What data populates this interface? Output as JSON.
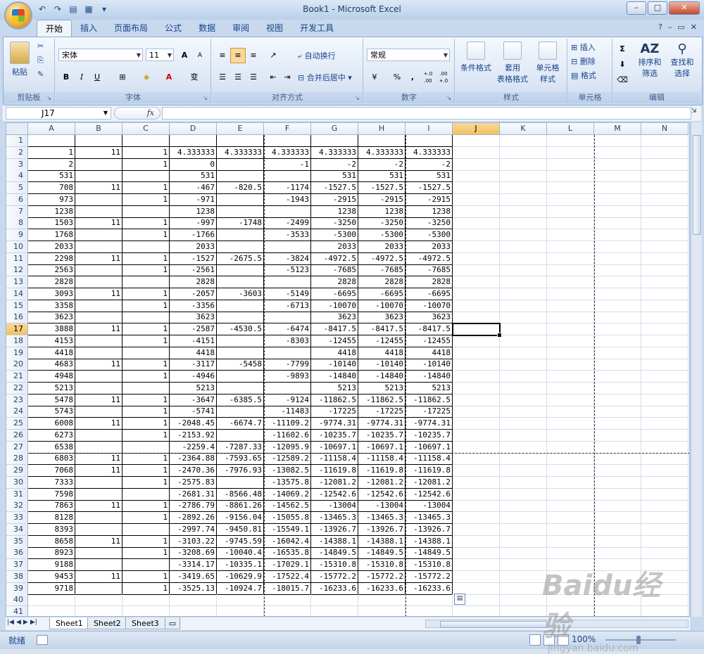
{
  "window": {
    "title": "Book1 - Microsoft Excel"
  },
  "ribbon": {
    "tabs": [
      "开始",
      "插入",
      "页面布局",
      "公式",
      "数据",
      "审阅",
      "视图",
      "开发工具"
    ],
    "active_tab": "开始",
    "clipboard": {
      "paste": "粘贴",
      "label": "剪贴板"
    },
    "font": {
      "name": "宋体",
      "size": "11",
      "label": "字体",
      "bold": "B",
      "italic": "I",
      "underline": "U",
      "grow": "A",
      "shrink": "A",
      "phonetic": "变"
    },
    "alignment": {
      "wrap": "自动换行",
      "merge": "合并后居中",
      "label": "对齐方式"
    },
    "number": {
      "format": "常规",
      "percent": "%",
      "comma": ",",
      "inc_dec": "+.0 .00",
      "dec_dec": ".00 +.0",
      "label": "数字"
    },
    "styles": {
      "conditional": "条件格式",
      "table_style_1": "套用",
      "table_style_2": "表格格式",
      "cell_style_1": "单元格",
      "cell_style_2": "样式",
      "label": "样式"
    },
    "cells": {
      "insert": "插入",
      "delete": "删除",
      "format": "格式",
      "label": "单元格"
    },
    "editing": {
      "sum": "Σ",
      "sort_1": "排序和",
      "sort_2": "筛选",
      "find_1": "查找和",
      "find_2": "选择",
      "label": "编辑"
    }
  },
  "formula_bar": {
    "name_box": "J17",
    "fx": "fx",
    "formula": ""
  },
  "sheet": {
    "columns": [
      "A",
      "B",
      "C",
      "D",
      "E",
      "F",
      "G",
      "H",
      "I",
      "J",
      "K",
      "L",
      "M",
      "N"
    ],
    "selected_cell": "J17",
    "rows": [
      [
        "",
        "",
        "",
        "",
        "",
        "",
        "",
        "",
        ""
      ],
      [
        "1",
        "11",
        "1",
        "4.333333",
        "4.333333",
        "4.333333",
        "4.333333",
        "4.333333",
        "4.333333"
      ],
      [
        "2",
        "",
        "1",
        "0",
        "",
        "-1",
        "-2",
        "-2",
        "-2"
      ],
      [
        "531",
        "",
        "",
        "531",
        "",
        "",
        "531",
        "531",
        "531"
      ],
      [
        "708",
        "11",
        "1",
        "-467",
        "-820.5",
        "-1174",
        "-1527.5",
        "-1527.5",
        "-1527.5"
      ],
      [
        "973",
        "",
        "1",
        "-971",
        "",
        "-1943",
        "-2915",
        "-2915",
        "-2915"
      ],
      [
        "1238",
        "",
        "",
        "1238",
        "",
        "",
        "1238",
        "1238",
        "1238"
      ],
      [
        "1503",
        "11",
        "1",
        "-997",
        "-1748",
        "-2499",
        "-3250",
        "-3250",
        "-3250"
      ],
      [
        "1768",
        "",
        "1",
        "-1766",
        "",
        "-3533",
        "-5300",
        "-5300",
        "-5300"
      ],
      [
        "2033",
        "",
        "",
        "2033",
        "",
        "",
        "2033",
        "2033",
        "2033"
      ],
      [
        "2298",
        "11",
        "1",
        "-1527",
        "-2675.5",
        "-3824",
        "-4972.5",
        "-4972.5",
        "-4972.5"
      ],
      [
        "2563",
        "",
        "1",
        "-2561",
        "",
        "-5123",
        "-7685",
        "-7685",
        "-7685"
      ],
      [
        "2828",
        "",
        "",
        "2828",
        "",
        "",
        "2828",
        "2828",
        "2828"
      ],
      [
        "3093",
        "11",
        "1",
        "-2057",
        "-3603",
        "-5149",
        "-6695",
        "-6695",
        "-6695"
      ],
      [
        "3358",
        "",
        "1",
        "-3356",
        "",
        "-6713",
        "-10070",
        "-10070",
        "-10070"
      ],
      [
        "3623",
        "",
        "",
        "3623",
        "",
        "",
        "3623",
        "3623",
        "3623"
      ],
      [
        "3888",
        "11",
        "1",
        "-2587",
        "-4530.5",
        "-6474",
        "-8417.5",
        "-8417.5",
        "-8417.5"
      ],
      [
        "4153",
        "",
        "1",
        "-4151",
        "",
        "-8303",
        "-12455",
        "-12455",
        "-12455"
      ],
      [
        "4418",
        "",
        "",
        "4418",
        "",
        "",
        "4418",
        "4418",
        "4418"
      ],
      [
        "4683",
        "11",
        "1",
        "-3117",
        "-5458",
        "-7799",
        "-10140",
        "-10140",
        "-10140"
      ],
      [
        "4948",
        "",
        "1",
        "-4946",
        "",
        "-9893",
        "-14840",
        "-14840",
        "-14840"
      ],
      [
        "5213",
        "",
        "",
        "5213",
        "",
        "",
        "5213",
        "5213",
        "5213"
      ],
      [
        "5478",
        "11",
        "1",
        "-3647",
        "-6385.5",
        "-9124",
        "-11862.5",
        "-11862.5",
        "-11862.5"
      ],
      [
        "5743",
        "",
        "1",
        "-5741",
        "",
        "-11483",
        "-17225",
        "-17225",
        "-17225"
      ],
      [
        "6008",
        "11",
        "1",
        "-2048.45",
        "-6674.7",
        "-11109.2",
        "-9774.31",
        "-9774.31",
        "-9774.31"
      ],
      [
        "6273",
        "",
        "1",
        "-2153.92",
        "",
        "-11602.6",
        "-10235.7",
        "-10235.7",
        "-10235.7"
      ],
      [
        "6538",
        "",
        "",
        "-2259.4",
        "-7287.33",
        "-12095.9",
        "-10697.1",
        "-10697.1",
        "-10697.1"
      ],
      [
        "6803",
        "11",
        "1",
        "-2364.88",
        "-7593.65",
        "-12589.2",
        "-11158.4",
        "-11158.4",
        "-11158.4"
      ],
      [
        "7068",
        "11",
        "1",
        "-2470.36",
        "-7976.93",
        "-13082.5",
        "-11619.8",
        "-11619.8",
        "-11619.8"
      ],
      [
        "7333",
        "",
        "1",
        "-2575.83",
        "",
        "-13575.8",
        "-12081.2",
        "-12081.2",
        "-12081.2"
      ],
      [
        "7598",
        "",
        "",
        "-2681.31",
        "-8566.48",
        "-14069.2",
        "-12542.6",
        "-12542.6",
        "-12542.6"
      ],
      [
        "7863",
        "11",
        "1",
        "-2786.79",
        "-8861.26",
        "-14562.5",
        "-13004",
        "-13004",
        "-13004"
      ],
      [
        "8128",
        "",
        "1",
        "-2892.26",
        "-9156.04",
        "-15055.8",
        "-13465.3",
        "-13465.3",
        "-13465.3"
      ],
      [
        "8393",
        "",
        "",
        "-2997.74",
        "-9450.81",
        "-15549.1",
        "-13926.7",
        "-13926.7",
        "-13926.7"
      ],
      [
        "8658",
        "11",
        "1",
        "-3103.22",
        "-9745.59",
        "-16042.4",
        "-14388.1",
        "-14388.1",
        "-14388.1"
      ],
      [
        "8923",
        "",
        "1",
        "-3208.69",
        "-10040.4",
        "-16535.8",
        "-14849.5",
        "-14849.5",
        "-14849.5"
      ],
      [
        "9188",
        "",
        "",
        "-3314.17",
        "-10335.1",
        "-17029.1",
        "-15310.8",
        "-15310.8",
        "-15310.8"
      ],
      [
        "9453",
        "11",
        "1",
        "-3419.65",
        "-10629.9",
        "-17522.4",
        "-15772.2",
        "-15772.2",
        "-15772.2"
      ],
      [
        "9718",
        "",
        "1",
        "-3525.13",
        "-10924.7",
        "-18015.7",
        "-16233.6",
        "-16233.6",
        "-16233.6"
      ],
      [
        "",
        "",
        "",
        "",
        "",
        "",
        "",
        "",
        ""
      ],
      [
        "",
        "",
        "",
        "",
        "",
        "",
        "",
        "",
        ""
      ]
    ]
  },
  "sheet_tabs": [
    "Sheet1",
    "Sheet2",
    "Sheet3"
  ],
  "active_sheet": "Sheet1",
  "status": {
    "mode": "就绪",
    "zoom": "100%",
    "zoom_level": 1.0
  },
  "watermark": {
    "line1": "Baidu经验",
    "line2": "jingyan.baidu.com"
  }
}
